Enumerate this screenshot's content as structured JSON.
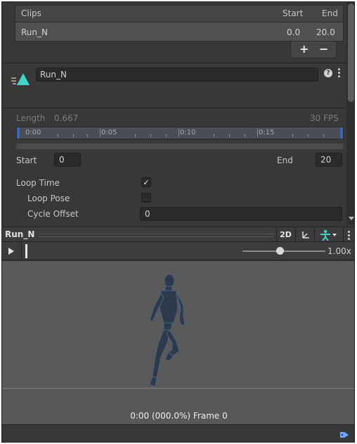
{
  "clips": {
    "header": {
      "name_label": "Clips",
      "start_label": "Start",
      "end_label": "End"
    },
    "rows": [
      {
        "name": "Run_N",
        "start": "0.0",
        "end": "20.0"
      }
    ],
    "add_label": "+",
    "remove_label": "−"
  },
  "clip_header": {
    "name_value": "Run_N",
    "help_label": "?",
    "icon": "animation-clip-icon"
  },
  "timeline": {
    "length_label": "Length",
    "length_value": "0.667",
    "fps_label": "30 FPS",
    "ticks": [
      "0:00",
      "0:05",
      "0:10",
      "0:15"
    ]
  },
  "range": {
    "start_label": "Start",
    "start_value": "0",
    "end_label": "End",
    "end_value": "20"
  },
  "loop": {
    "loop_time_label": "Loop Time",
    "loop_time_checked": true,
    "loop_pose_label": "Loop Pose",
    "loop_pose_checked": false,
    "cycle_offset_label": "Cycle Offset",
    "cycle_offset_value": "0"
  },
  "preview": {
    "title": "Run_N",
    "mode_2d_label": "2D",
    "speed_value": "1.00x",
    "speed_fraction": 0.45,
    "frame_label": "0:00 (000.0%) Frame 0"
  },
  "colors": {
    "panel_bg": "#383838",
    "accent_cyan": "#3fd6c8",
    "timeline_marker": "#3a66b8"
  }
}
